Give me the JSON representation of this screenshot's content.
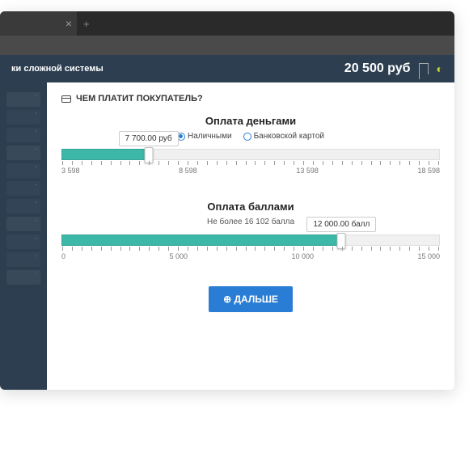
{
  "header": {
    "subtitle": "ки сложной системы",
    "price": "20 500 руб"
  },
  "card": {
    "title": "ЧЕМ ПЛАТИТ ПОКУПАТЕЛЬ?"
  },
  "money": {
    "title": "Оплата деньгами",
    "option_cash": "Наличными",
    "option_card": "Банковской картой",
    "value_label": "7 700.00 руб",
    "marks": {
      "m1": "3 598",
      "m2": "8 598",
      "m3": "13 598",
      "m4": "18 598"
    }
  },
  "points": {
    "title": "Оплата баллами",
    "subtitle": "Не более 16 102 балла",
    "value_label": "12 000.00 балл",
    "marks": {
      "m1": "0",
      "m2": "5 000",
      "m3": "10 000",
      "m4": "15 000"
    }
  },
  "next_button": "ДАЛЬШЕ"
}
